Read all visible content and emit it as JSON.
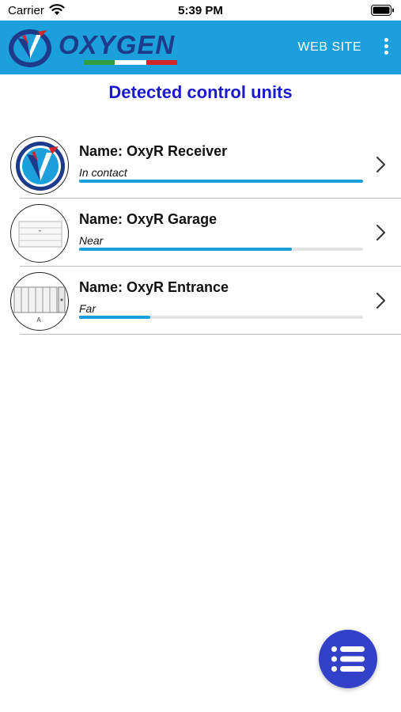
{
  "status_bar": {
    "carrier": "Carrier",
    "time": "5:39 PM",
    "wifi_icon": "wifi-icon",
    "battery_icon": "battery-full-icon"
  },
  "app_bar": {
    "logo_text": "OXYGEN",
    "web_site_label": "WEB SITE",
    "menu_icon": "more-vertical-icon",
    "color": "#1ba0dc"
  },
  "page": {
    "title": "Detected control units",
    "title_color": "#1a1acc"
  },
  "units": [
    {
      "name": "Name: OxyR Receiver",
      "status": "In contact",
      "signal": 1.0,
      "thumb_icon": "oxygen-logo-icon"
    },
    {
      "name": "Name: OxyR Garage",
      "status": "Near",
      "signal": 0.75,
      "thumb_icon": "garage-door-icon"
    },
    {
      "name": "Name: OxyR Entrance",
      "status": "Far",
      "signal": 0.25,
      "thumb_icon": "gate-icon"
    }
  ],
  "fab": {
    "icon": "list-icon",
    "color": "#3341c9"
  }
}
